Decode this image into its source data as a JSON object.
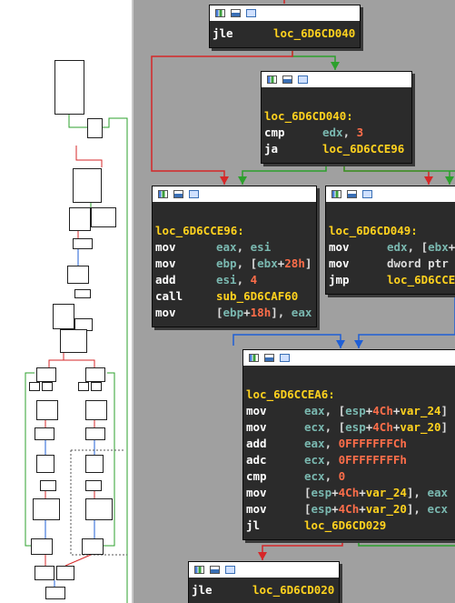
{
  "blocks": [
    {
      "id": "b0",
      "lines": [
        [
          {
            "t": "jle",
            "c": "mnem"
          },
          {
            "t": "loc_6D6CD040",
            "c": "lbl"
          }
        ]
      ]
    },
    {
      "id": "b1",
      "lines": [
        [],
        [
          {
            "t": "loc_6D6CD040:",
            "c": "lbl"
          }
        ],
        [
          {
            "t": "cmp",
            "c": "mnem"
          },
          {
            "t": "edx",
            "c": "reg"
          },
          {
            "t": ", ",
            "c": "txt"
          },
          {
            "t": "3",
            "c": "num"
          }
        ],
        [
          {
            "t": "ja",
            "c": "mnem"
          },
          {
            "t": "loc_6D6CCE96",
            "c": "lbl"
          }
        ]
      ]
    },
    {
      "id": "b2",
      "lines": [
        [],
        [
          {
            "t": "loc_6D6CCE96:",
            "c": "lbl"
          }
        ],
        [
          {
            "t": "mov",
            "c": "mnem"
          },
          {
            "t": "eax",
            "c": "reg"
          },
          {
            "t": ", ",
            "c": "txt"
          },
          {
            "t": "esi",
            "c": "reg"
          }
        ],
        [
          {
            "t": "mov",
            "c": "mnem"
          },
          {
            "t": "ebp",
            "c": "reg"
          },
          {
            "t": ", [",
            "c": "txt"
          },
          {
            "t": "ebx",
            "c": "reg"
          },
          {
            "t": "+",
            "c": "txt"
          },
          {
            "t": "28h",
            "c": "num"
          },
          {
            "t": "]",
            "c": "txt"
          }
        ],
        [
          {
            "t": "add",
            "c": "mnem"
          },
          {
            "t": "esi",
            "c": "reg"
          },
          {
            "t": ", ",
            "c": "txt"
          },
          {
            "t": "4",
            "c": "num"
          }
        ],
        [
          {
            "t": "call",
            "c": "mnem"
          },
          {
            "t": "sub_6D6CAF60",
            "c": "lbl"
          }
        ],
        [
          {
            "t": "mov",
            "c": "mnem"
          },
          {
            "t": "[",
            "c": "txt"
          },
          {
            "t": "ebp",
            "c": "reg"
          },
          {
            "t": "+",
            "c": "txt"
          },
          {
            "t": "18h",
            "c": "num"
          },
          {
            "t": "], ",
            "c": "txt"
          },
          {
            "t": "eax",
            "c": "reg"
          }
        ]
      ]
    },
    {
      "id": "b3",
      "lines": [
        [],
        [
          {
            "t": "loc_6D6CD049:",
            "c": "lbl"
          }
        ],
        [
          {
            "t": "mov",
            "c": "mnem"
          },
          {
            "t": "edx",
            "c": "reg"
          },
          {
            "t": ", [",
            "c": "txt"
          },
          {
            "t": "ebx",
            "c": "reg"
          },
          {
            "t": "+",
            "c": "txt"
          }
        ],
        [
          {
            "t": "mov",
            "c": "mnem"
          },
          {
            "t": "dword ptr",
            "c": "txt"
          }
        ],
        [
          {
            "t": "jmp",
            "c": "mnem"
          },
          {
            "t": "loc_6D6CCE",
            "c": "lbl"
          }
        ]
      ]
    },
    {
      "id": "b4",
      "lines": [
        [],
        [
          {
            "t": "loc_6D6CCEA6:",
            "c": "lbl"
          }
        ],
        [
          {
            "t": "mov",
            "c": "mnem"
          },
          {
            "t": "eax",
            "c": "reg"
          },
          {
            "t": ", [",
            "c": "txt"
          },
          {
            "t": "esp",
            "c": "reg"
          },
          {
            "t": "+",
            "c": "txt"
          },
          {
            "t": "4Ch",
            "c": "num"
          },
          {
            "t": "+",
            "c": "txt"
          },
          {
            "t": "var_24",
            "c": "lbl"
          },
          {
            "t": "]",
            "c": "txt"
          }
        ],
        [
          {
            "t": "mov",
            "c": "mnem"
          },
          {
            "t": "ecx",
            "c": "reg"
          },
          {
            "t": ", [",
            "c": "txt"
          },
          {
            "t": "esp",
            "c": "reg"
          },
          {
            "t": "+",
            "c": "txt"
          },
          {
            "t": "4Ch",
            "c": "num"
          },
          {
            "t": "+",
            "c": "txt"
          },
          {
            "t": "var_20",
            "c": "lbl"
          },
          {
            "t": "]",
            "c": "txt"
          }
        ],
        [
          {
            "t": "add",
            "c": "mnem"
          },
          {
            "t": "eax",
            "c": "reg"
          },
          {
            "t": ", ",
            "c": "txt"
          },
          {
            "t": "0FFFFFFFCh",
            "c": "num"
          }
        ],
        [
          {
            "t": "adc",
            "c": "mnem"
          },
          {
            "t": "ecx",
            "c": "reg"
          },
          {
            "t": ", ",
            "c": "txt"
          },
          {
            "t": "0FFFFFFFFh",
            "c": "num"
          }
        ],
        [
          {
            "t": "cmp",
            "c": "mnem"
          },
          {
            "t": "ecx",
            "c": "reg"
          },
          {
            "t": ", ",
            "c": "txt"
          },
          {
            "t": "0",
            "c": "num"
          }
        ],
        [
          {
            "t": "mov",
            "c": "mnem"
          },
          {
            "t": "[",
            "c": "txt"
          },
          {
            "t": "esp",
            "c": "reg"
          },
          {
            "t": "+",
            "c": "txt"
          },
          {
            "t": "4Ch",
            "c": "num"
          },
          {
            "t": "+",
            "c": "txt"
          },
          {
            "t": "var_24",
            "c": "lbl"
          },
          {
            "t": "], ",
            "c": "txt"
          },
          {
            "t": "eax",
            "c": "reg"
          }
        ],
        [
          {
            "t": "mov",
            "c": "mnem"
          },
          {
            "t": "[",
            "c": "txt"
          },
          {
            "t": "esp",
            "c": "reg"
          },
          {
            "t": "+",
            "c": "txt"
          },
          {
            "t": "4Ch",
            "c": "num"
          },
          {
            "t": "+",
            "c": "txt"
          },
          {
            "t": "var_20",
            "c": "lbl"
          },
          {
            "t": "], ",
            "c": "txt"
          },
          {
            "t": "ecx",
            "c": "reg"
          }
        ],
        [
          {
            "t": "jl",
            "c": "mnem"
          },
          {
            "t": "loc_6D6CD029",
            "c": "lbl"
          }
        ]
      ]
    },
    {
      "id": "b5",
      "lines": [
        [
          {
            "t": "jle",
            "c": "mnem"
          },
          {
            "t": "loc_6D6CD020",
            "c": "lbl"
          }
        ]
      ]
    }
  ],
  "header_icons": [
    "graph-icon",
    "bookmark-icon",
    "comment-icon"
  ],
  "colors": {
    "edge_true": "#2ca02c",
    "edge_false": "#d62728",
    "edge_uncond": "#1f5fd6",
    "graph_bg": "#a0a0a0",
    "node_bg": "#2b2b2b",
    "label": "#ffd21e",
    "register": "#7ab8b0",
    "number": "#ff6e4a"
  }
}
